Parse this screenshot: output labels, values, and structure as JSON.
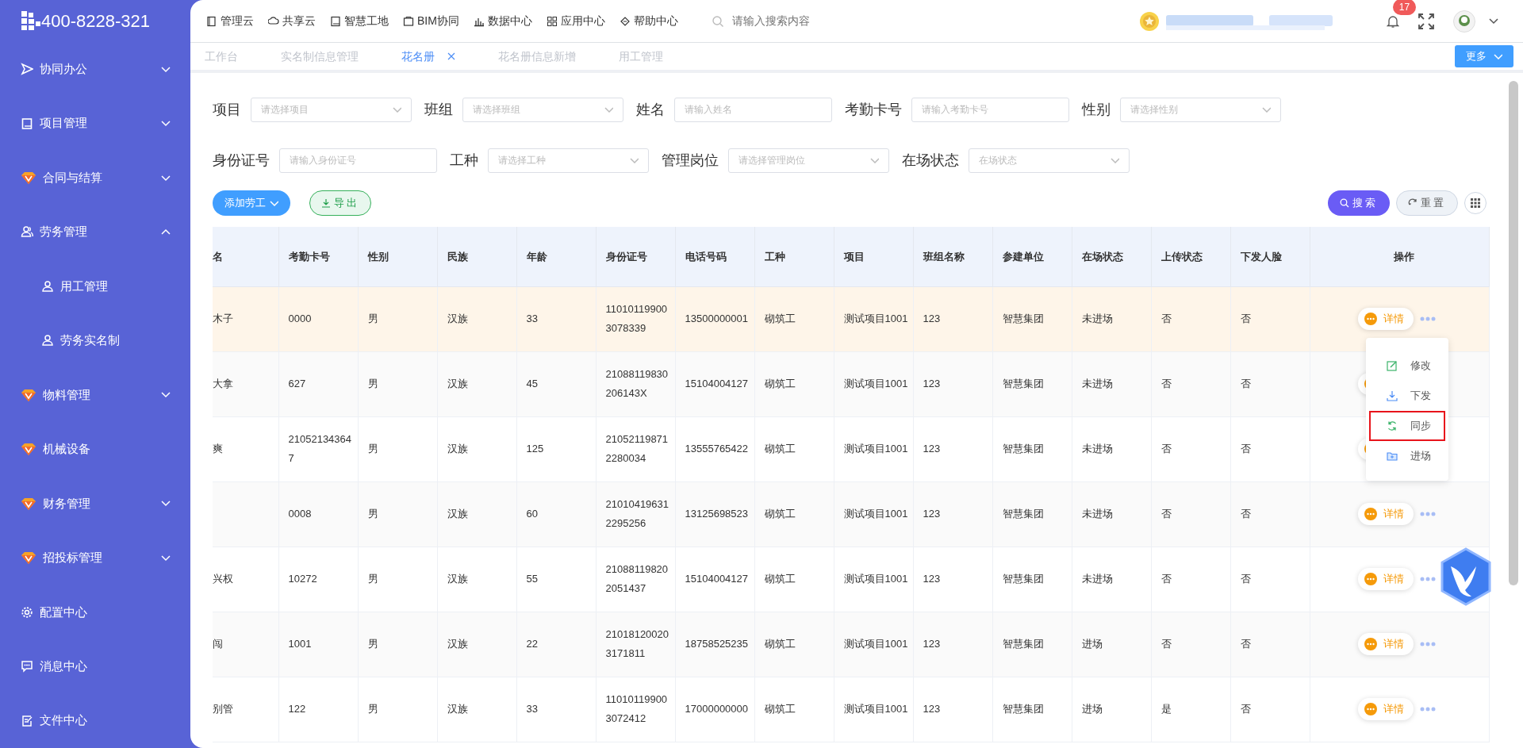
{
  "sidebar": {
    "phone": "400-8228-321",
    "items": [
      {
        "label": "协同办公",
        "expanded": false
      },
      {
        "label": "项目管理",
        "expanded": false
      },
      {
        "label": "合同与结算",
        "expanded": false
      },
      {
        "label": "劳务管理",
        "expanded": true,
        "children": [
          {
            "label": "用工管理"
          },
          {
            "label": "劳务实名制"
          }
        ]
      },
      {
        "label": "物料管理",
        "expanded": false
      },
      {
        "label": "机械设备"
      },
      {
        "label": "财务管理",
        "expanded": false
      },
      {
        "label": "招投标管理",
        "expanded": false
      },
      {
        "label": "配置中心"
      },
      {
        "label": "消息中心"
      },
      {
        "label": "文件中心"
      }
    ]
  },
  "top_nav": {
    "items": [
      "管理云",
      "共享云",
      "智慧工地",
      "BIM协同",
      "数据中心",
      "应用中心",
      "帮助中心"
    ],
    "search": {
      "placeholder": "请输入搜索内容"
    },
    "notifications": "17"
  },
  "tabs": [
    {
      "label": "工作台",
      "selected": false
    },
    {
      "label": "实名制信息管理",
      "selected": false
    },
    {
      "label": "花名册",
      "selected": true,
      "closable": true
    },
    {
      "label": "花名册信息新增",
      "selected": false
    },
    {
      "label": "用工管理",
      "selected": false
    }
  ],
  "more_button": "更多",
  "filters": [
    [
      {
        "label": "项目",
        "kind": "select",
        "placeholder": "请选择项目"
      },
      {
        "label": "班组",
        "kind": "select",
        "placeholder": "请选择班组"
      },
      {
        "label": "姓名",
        "kind": "input",
        "placeholder": "请输入姓名"
      },
      {
        "label": "考勤卡号",
        "kind": "input",
        "placeholder": "请输入考勤卡号"
      },
      {
        "label": "性别",
        "kind": "select",
        "placeholder": "请选择性别"
      }
    ],
    [
      {
        "label": "身份证号",
        "kind": "input",
        "placeholder": "请输入身份证号"
      },
      {
        "label": "工种",
        "kind": "select",
        "placeholder": "请选择工种"
      },
      {
        "label": "管理岗位",
        "kind": "select",
        "placeholder": "请选择管理岗位"
      },
      {
        "label": "在场状态",
        "kind": "select",
        "placeholder": "在场状态"
      }
    ]
  ],
  "actions": {
    "add": "添加劳工",
    "export": "导出",
    "search": "搜索",
    "reset": "重置"
  },
  "table": {
    "columns": [
      "名",
      "考勤卡号",
      "性别",
      "民族",
      "年龄",
      "身份证号",
      "电话号码",
      "工种",
      "项目",
      "班组名称",
      "参建单位",
      "在场状态",
      "上传状态",
      "下发人脸",
      "操作"
    ],
    "rows": [
      {
        "highlighted": true,
        "cells": [
          "木子",
          "0000",
          "男",
          "汉族",
          "33",
          "110101199003078339",
          "13500000001",
          "砌筑工",
          "测试项目1001",
          "123",
          "智慧集团",
          "未进场",
          "否",
          "否"
        ],
        "detail": "详情"
      },
      {
        "highlighted": false,
        "cells": [
          "大拿",
          "627",
          "男",
          "汉族",
          "45",
          "21088119830206143X",
          "15104004127",
          "砌筑工",
          "测试项目1001",
          "123",
          "智慧集团",
          "未进场",
          "否",
          "否"
        ]
      },
      {
        "highlighted": false,
        "cells": [
          "爽",
          "210521343647",
          "男",
          "汉族",
          "125",
          "210521198712280034",
          "13555765422",
          "砌筑工",
          "测试项目1001",
          "123",
          "智慧集团",
          "未进场",
          "否",
          "否"
        ]
      },
      {
        "highlighted": false,
        "cells": [
          null,
          "0008",
          "男",
          "汉族",
          "60",
          "210104196312295256",
          "13125698523",
          "砌筑工",
          "测试项目1001",
          "123",
          "智慧集团",
          "未进场",
          "否",
          "否"
        ],
        "detail": "详情"
      },
      {
        "highlighted": false,
        "cells": [
          "兴权",
          "10272",
          "男",
          "汉族",
          "55",
          "210881198202051437",
          "15104004127",
          "砌筑工",
          "测试项目1001",
          "123",
          "智慧集团",
          "未进场",
          "否",
          "否"
        ],
        "detail": "详情"
      },
      {
        "highlighted": false,
        "cells": [
          "闯",
          "1001",
          "男",
          "汉族",
          "22",
          "210181200203171811",
          "18758525235",
          "砌筑工",
          "测试项目1001",
          "123",
          "智慧集团",
          "进场",
          "否",
          "否"
        ],
        "detail": "详情"
      },
      {
        "highlighted": false,
        "cells": [
          "别管",
          "122",
          "男",
          "汉族",
          "33",
          "110101199003072412",
          "17000000000",
          "砌筑工",
          "测试项目1001",
          "123",
          "智慧集团",
          "进场",
          "是",
          "否"
        ],
        "detail": "详情"
      }
    ]
  },
  "menu": {
    "items": [
      {
        "label": "修改",
        "selected": false
      },
      {
        "label": "下发",
        "selected": false
      },
      {
        "label": "同步",
        "selected": true
      },
      {
        "label": "进场",
        "selected": false
      }
    ]
  }
}
